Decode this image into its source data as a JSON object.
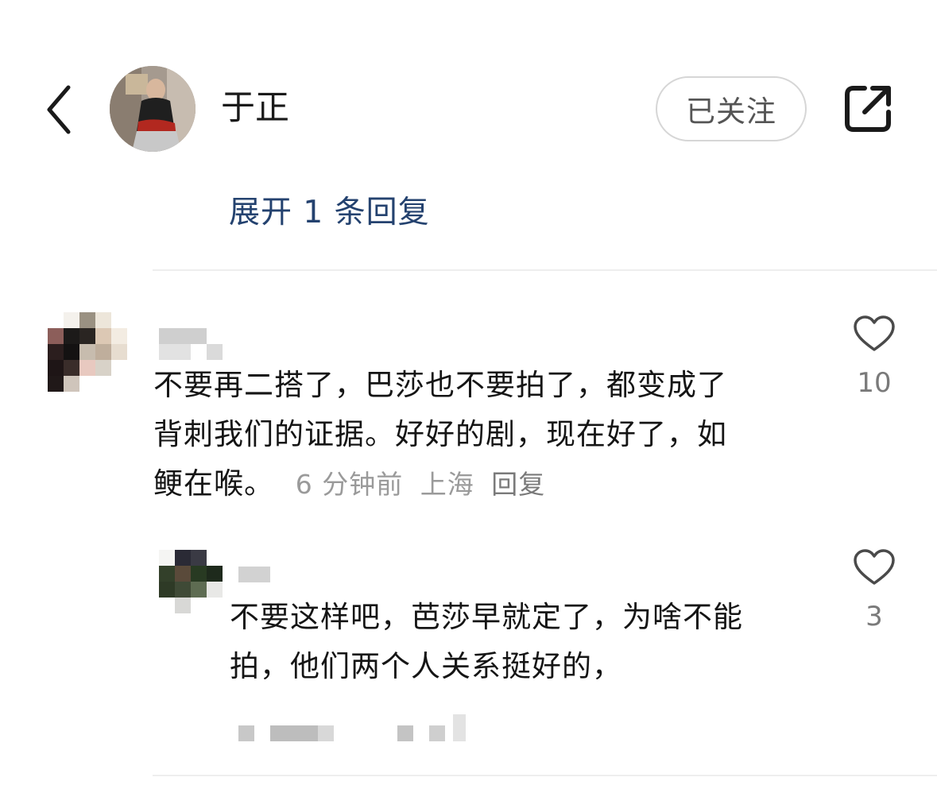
{
  "header": {
    "username": "于正",
    "follow_label": "已关注"
  },
  "expand_replies": "展开 1 条回复",
  "comments": [
    {
      "lines": [
        "不要再二搭了，巴莎也不要拍了，都变成了",
        "背刺我们的证据。好好的剧，现在好了，如",
        "鲠在喉。"
      ],
      "time": "6 分钟前",
      "location": "上海",
      "reply_label": "回复",
      "likes": "10"
    },
    {
      "lines": [
        "不要这样吧，芭莎早就定了，为啥不能",
        "拍，他们两个人关系挺好的，"
      ],
      "likes": "3"
    }
  ],
  "icons": {
    "back": "chevron-left-icon",
    "share": "share-external-icon",
    "like": "heart-outline-icon"
  },
  "colors": {
    "link": "#24426f",
    "meta": "#9a9a9a",
    "border": "#d6d6d6"
  }
}
